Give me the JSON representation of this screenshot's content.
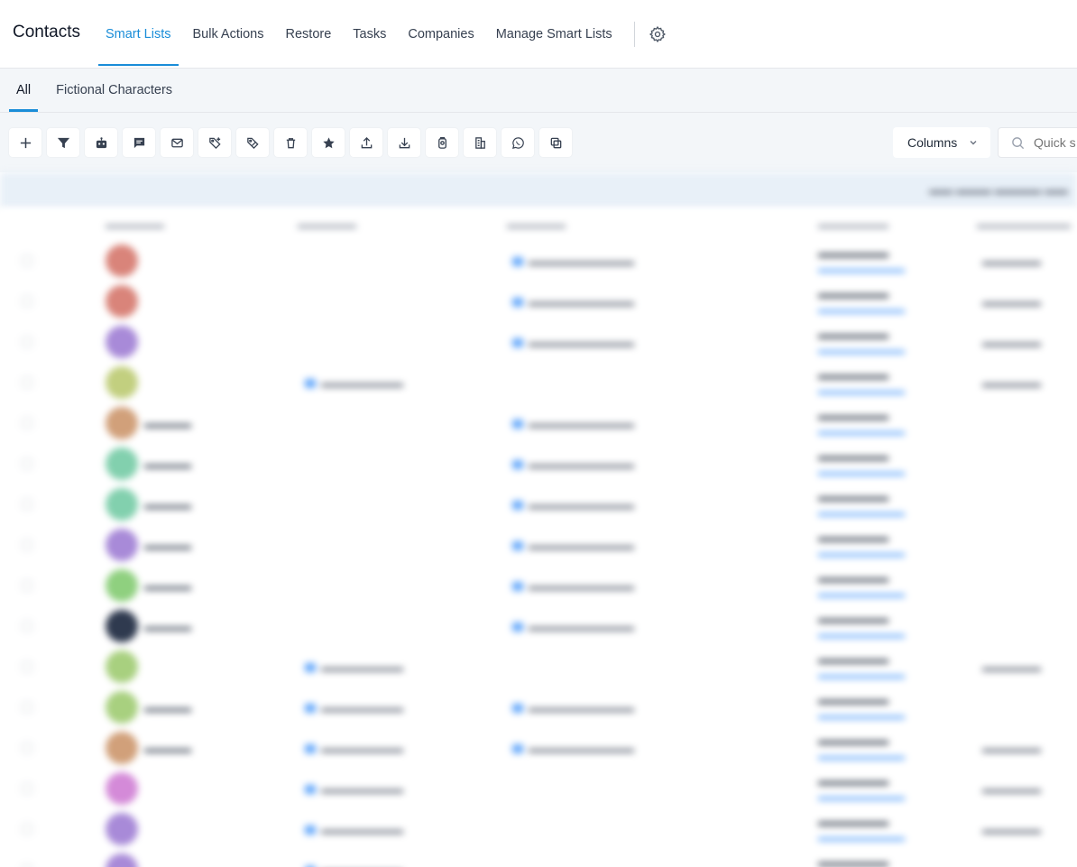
{
  "app_title": "Contacts",
  "top_tabs": [
    {
      "label": "Smart Lists",
      "active": true
    },
    {
      "label": "Bulk Actions",
      "active": false
    },
    {
      "label": "Restore",
      "active": false
    },
    {
      "label": "Tasks",
      "active": false
    },
    {
      "label": "Companies",
      "active": false
    },
    {
      "label": "Manage Smart Lists",
      "active": false
    }
  ],
  "sub_tabs": [
    {
      "label": "All",
      "active": true
    },
    {
      "label": "Fictional Characters",
      "active": false
    }
  ],
  "toolbar": {
    "icons": [
      "add-icon",
      "filter-icon",
      "automation-icon",
      "sms-icon",
      "email-icon",
      "add-tag-icon",
      "remove-tag-icon",
      "delete-icon",
      "star-icon",
      "export-icon",
      "import-icon",
      "review-icon",
      "company-icon",
      "whatsapp-icon",
      "merge-icon"
    ],
    "columns_label": "Columns",
    "search_placeholder": "Quick s"
  },
  "accent_color": "#1a8dd8",
  "avatar_colors": [
    "#d9847a",
    "#d9847a",
    "#a88ad8",
    "#c2cf7f",
    "#d1a07a",
    "#82d0ae",
    "#82d0ae",
    "#a88ad8",
    "#8fd07f",
    "#2f3a4f",
    "#a8d07f",
    "#a8d07f",
    "#d1a07a",
    "#d48ad8",
    "#a88ad8",
    "#a88ad8"
  ]
}
